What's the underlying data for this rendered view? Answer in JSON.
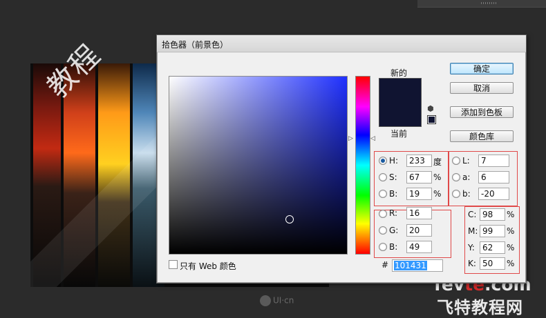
{
  "poster": {
    "title_text": "教程",
    "logo_text": "UI·cn"
  },
  "watermark": {
    "line1_a": "fev",
    "line1_b": "te",
    "line1_c": ".com",
    "line2": "飞特教程网"
  },
  "dialog": {
    "title": "拾色器（前景色）",
    "new_label": "新的",
    "current_label": "当前",
    "new_color": "#101431",
    "current_color": "#101431",
    "buttons": {
      "ok": "确定",
      "cancel": "取消",
      "add_swatch": "添加到色板",
      "libraries": "颜色库"
    },
    "hsb": {
      "h": {
        "label": "H:",
        "value": "233",
        "unit": "度"
      },
      "s": {
        "label": "S:",
        "value": "67",
        "unit": "%"
      },
      "b": {
        "label": "B:",
        "value": "19",
        "unit": "%"
      }
    },
    "lab": {
      "l": {
        "label": "L:",
        "value": "7"
      },
      "a": {
        "label": "a:",
        "value": "6"
      },
      "b": {
        "label": "b:",
        "value": "-20"
      }
    },
    "rgb": {
      "r": {
        "label": "R:",
        "value": "16"
      },
      "g": {
        "label": "G:",
        "value": "20"
      },
      "b": {
        "label": "B:",
        "value": "49"
      }
    },
    "cmyk": {
      "c": {
        "label": "C:",
        "value": "98",
        "unit": "%"
      },
      "m": {
        "label": "M:",
        "value": "99",
        "unit": "%"
      },
      "y": {
        "label": "Y:",
        "value": "62",
        "unit": "%"
      },
      "k": {
        "label": "K:",
        "value": "50",
        "unit": "%"
      }
    },
    "web_only_label": "只有 Web 颜色",
    "hex_label": "#",
    "hex_value": "101431"
  }
}
